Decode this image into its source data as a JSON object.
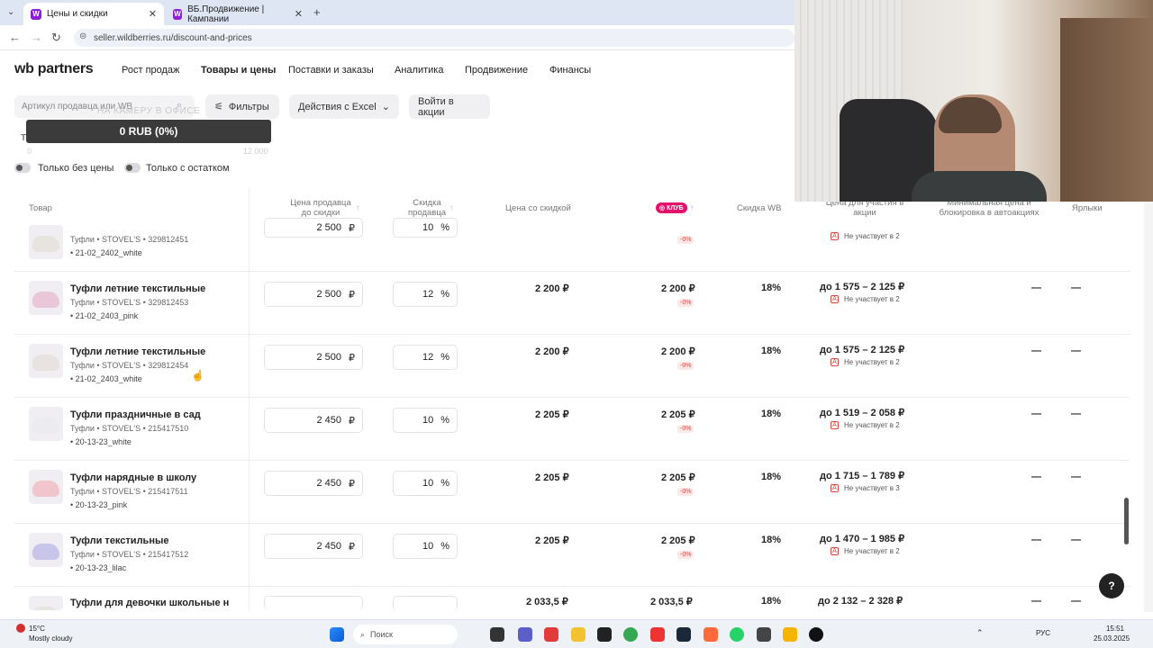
{
  "browser": {
    "tabs": [
      {
        "title": "Цены и скидки",
        "active": true
      },
      {
        "title": "ВБ.Продвижение | Кампании",
        "active": false
      }
    ],
    "url": "seller.wildberries.ru/discount-and-prices"
  },
  "brand": {
    "logo": "wb partners",
    "accent": "#8b1fd6"
  },
  "nav": {
    "items": [
      "Рост продаж",
      "Товары и цены",
      "Поставки и заказы",
      "Аналитика",
      "Продвижение",
      "Финансы"
    ],
    "active": "Товары и цены"
  },
  "toolbar": {
    "search_placeholder": "Артикул продавца или WB",
    "filters": "Фильтры",
    "excel": "Действия с Excel",
    "promo": "Войти в акции"
  },
  "overlay": {
    "caption": "НА КАМЕРУ В ОФИСЕ",
    "progress_text": "0 RUB (0%)",
    "scale_min": "0",
    "scale_max": "12 000",
    "progress_fraction": 0
  },
  "toggles": [
    "Только без цены",
    "Только с остатком"
  ],
  "table": {
    "headers": {
      "product": "Товар",
      "seller_price": "Цена продавца до скидки",
      "seller_discount": "Скидка продавца",
      "discounted_price": "Цена со скидкой",
      "club": "КЛУБ",
      "wb_discount": "Скидка WB",
      "promo_price": "Цена для участия в акции",
      "min_price": "Минимальная цена и блокировка в автоакциях",
      "labels": "Ярлыки"
    },
    "partial_top_row": {
      "meta": "Туфли • STOVEL'S • 329812451",
      "vendor_code": "• 21-02_2402_white",
      "price": "2 500",
      "discount": "10",
      "club_pct": "-0%",
      "promo_status": "Не участвует в 2"
    },
    "rows": [
      {
        "name": "Туфли летние текстильные",
        "meta": "Туфли • STOVEL'S • 329812453",
        "vendor_code": "• 21-02_2403_pink",
        "price": "2 500",
        "currency": "₽",
        "discount": "12",
        "pct_sign": "%",
        "discounted": "2 200 ₽",
        "club_price": "2 200 ₽",
        "club_pct": "-0%",
        "wb_discount": "18%",
        "promo_range": "до 1 575 – 2 125 ₽",
        "promo_status": "Не участвует в 2",
        "min_price": "—",
        "labels": "—",
        "thumb_color": "#e9c7d8"
      },
      {
        "name": "Туфли летние текстильные",
        "meta": "Туфли • STOVEL'S • 329812454",
        "vendor_code": "• 21-02_2403_white",
        "price": "2 500",
        "currency": "₽",
        "discount": "12",
        "pct_sign": "%",
        "discounted": "2 200 ₽",
        "club_price": "2 200 ₽",
        "club_pct": "-0%",
        "wb_discount": "18%",
        "promo_range": "до 1 575 – 2 125 ₽",
        "promo_status": "Не участвует в 2",
        "min_price": "—",
        "labels": "—",
        "thumb_color": "#e8e3e0"
      },
      {
        "name": "Туфли праздничные в сад",
        "meta": "Туфли • STOVEL'S • 215417510",
        "vendor_code": "• 20-13-23_white",
        "price": "2 450",
        "currency": "₽",
        "discount": "10",
        "pct_sign": "%",
        "discounted": "2 205 ₽",
        "club_price": "2 205 ₽",
        "club_pct": "-0%",
        "wb_discount": "18%",
        "promo_range": "до 1 519 – 2 058 ₽",
        "promo_status": "Не участвует в 2",
        "min_price": "—",
        "labels": "—",
        "thumb_color": "#ecebf0"
      },
      {
        "name": "Туфли нарядные в школу",
        "meta": "Туфли • STOVEL'S • 215417511",
        "vendor_code": "• 20-13-23_pink",
        "price": "2 450",
        "currency": "₽",
        "discount": "10",
        "pct_sign": "%",
        "discounted": "2 205 ₽",
        "club_price": "2 205 ₽",
        "club_pct": "-0%",
        "wb_discount": "18%",
        "promo_range": "до 1 715 – 1 789 ₽",
        "promo_status": "Не участвует в 3",
        "min_price": "—",
        "labels": "—",
        "thumb_color": "#f0c5cc"
      },
      {
        "name": "Туфли текстильные",
        "meta": "Туфли • STOVEL'S • 215417512",
        "vendor_code": "• 20-13-23_lilac",
        "price": "2 450",
        "currency": "₽",
        "discount": "10",
        "pct_sign": "%",
        "discounted": "2 205 ₽",
        "club_price": "2 205 ₽",
        "club_pct": "-0%",
        "wb_discount": "18%",
        "promo_range": "до 1 470 – 1 985 ₽",
        "promo_status": "Не участвует в 2",
        "min_price": "—",
        "labels": "—",
        "thumb_color": "#c9c4ea"
      }
    ],
    "partial_bottom_row": {
      "name": "Туфли для девочки школьные н",
      "discounted": "2 033,5 ₽",
      "club_price": "2 033,5 ₽",
      "wb_discount": "18%",
      "promo_range": "до 2 132 – 2 328 ₽",
      "min_price": "—",
      "labels": "—"
    }
  },
  "help": "?",
  "taskbar": {
    "weather_temp": "15°C",
    "weather_desc": "Mostly cloudy",
    "search": "Поиск",
    "lang": "РУС",
    "time": "15:51",
    "date": "25.03.2025"
  }
}
